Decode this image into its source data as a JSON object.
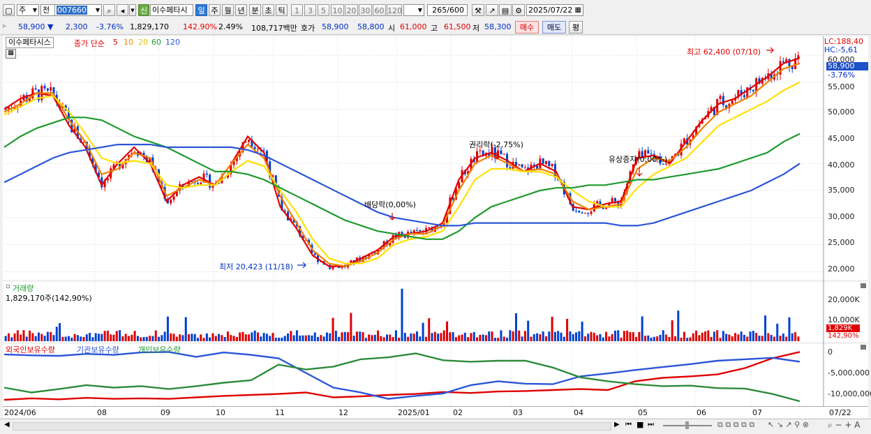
{
  "toolbar": {
    "market": "주",
    "range": "전",
    "code": "007660",
    "stock_name": "이수페타시",
    "badge": "신",
    "periods": [
      "일",
      "주",
      "월",
      "년",
      "분",
      "초",
      "틱"
    ],
    "active_period": "일",
    "intervals": [
      "1",
      "3",
      "5",
      "10",
      "20",
      "30",
      "60",
      "120"
    ],
    "count": "265",
    "count_total": "/600",
    "date": "2025/07/22"
  },
  "quote": {
    "price": "58,900",
    "change": "2,300",
    "change_pct": "-3.76%",
    "volume": "1,829,170",
    "vol_ratio": "142.90%",
    "turnover": "2.49%",
    "amount": "108,717백만",
    "ask_label": "호가",
    "ask": "58,900",
    "bid": "58,800",
    "open_label": "시",
    "open": "61,000",
    "high_label": "고",
    "high": "61,500",
    "low_label": "저",
    "low": "58,300",
    "buy": "매수",
    "sell": "매도",
    "eval": "평"
  },
  "price_panel": {
    "stock_tag": "이수페타시스",
    "ma_title": "종가 단순",
    "ma_periods": [
      "5",
      "10",
      "20",
      "60",
      "120"
    ],
    "lc": "LC:188,40",
    "hc": "HC:-5,61",
    "current_price": "58,900",
    "current_pct": "-3.76%",
    "high_note": "최고 62,400 (07/10)",
    "low_note": "최저 20,423 (11/18)",
    "ann_dividend": "배당락(0,00%)",
    "ann_rights": "권리락(-2,75%)",
    "ann_capital": "유상증자(0,00%)",
    "y_labels": [
      "60,000",
      "55,000",
      "50,000",
      "45,000",
      "40,000",
      "35,000",
      "30,000",
      "25,000",
      "20,000"
    ]
  },
  "volume_panel": {
    "title": "거래량",
    "value": "1,829,170주(142,90%)",
    "y_labels": [
      "20,000K",
      "10,000K"
    ],
    "current": "1,829K",
    "current_pct": "142,90%"
  },
  "holding_panel": {
    "legend": [
      "외국인보유수량",
      "기관보유수량",
      "개인보유수량"
    ],
    "y_labels": [
      "0",
      "-5,000,000",
      "-10,000,000"
    ]
  },
  "x_labels": [
    "2024/06",
    "08",
    "09",
    "10",
    "11",
    "12",
    "2025/01",
    "02",
    "03",
    "04",
    "05",
    "06",
    "07",
    "07/22"
  ],
  "colors": {
    "up": "#e00000",
    "down": "#0040d0",
    "ma5": "#e00000",
    "ma10": "#f08000",
    "ma20": "#ffe000",
    "ma60": "#1e9a2e",
    "ma120": "#2a55d8"
  },
  "chart_data": {
    "type": "candlestick",
    "price_ylim": [
      18500,
      63500
    ],
    "ma_series": [
      {
        "name": "5",
        "values": [
          50000,
          52000,
          53000,
          52500,
          47000,
          43000,
          36000,
          40000,
          43000,
          40000,
          33000,
          36000,
          37500,
          36000,
          40000,
          45000,
          42000,
          32000,
          28000,
          23000,
          21000,
          21000,
          22500,
          24000,
          26500,
          27000,
          27500,
          29000,
          37000,
          41000,
          42000,
          40500,
          38500,
          40000,
          38500,
          32000,
          31500,
          32500,
          33000,
          41000,
          41500,
          40000,
          44000,
          48000,
          51000,
          52000,
          54000,
          56000,
          58500,
          59500
        ]
      },
      {
        "name": "10",
        "values": [
          49500,
          51000,
          53000,
          53000,
          48000,
          44000,
          38000,
          39000,
          42000,
          41000,
          34000,
          35500,
          37000,
          36000,
          40000,
          43500,
          41000,
          34000,
          29000,
          24000,
          21500,
          21000,
          22000,
          23500,
          26000,
          27000,
          27000,
          28500,
          35000,
          40000,
          41500,
          40000,
          38500,
          39000,
          38000,
          33000,
          31500,
          32000,
          32500,
          39000,
          41000,
          40500,
          43000,
          46500,
          49500,
          51000,
          52500,
          55000,
          57500,
          58500
        ]
      },
      {
        "name": "20",
        "values": [
          49000,
          50500,
          52000,
          52500,
          49500,
          45500,
          41000,
          40000,
          40500,
          40000,
          36000,
          35500,
          36000,
          36000,
          38500,
          40500,
          39500,
          35000,
          31000,
          26000,
          22500,
          21500,
          21500,
          22500,
          25000,
          26000,
          26500,
          27500,
          32000,
          37000,
          39000,
          39000,
          38500,
          38500,
          37500,
          35000,
          33000,
          32000,
          32000,
          35500,
          38000,
          39500,
          41000,
          44000,
          47000,
          48500,
          50000,
          51500,
          53500,
          55000
        ]
      },
      {
        "name": "60",
        "values": [
          43000,
          45000,
          46500,
          47500,
          48500,
          48500,
          48000,
          46500,
          45000,
          44000,
          43000,
          41500,
          40000,
          38500,
          38500,
          38000,
          37000,
          35500,
          34000,
          32500,
          31000,
          29500,
          28500,
          27500,
          27000,
          26500,
          26000,
          26000,
          27500,
          30000,
          32000,
          33000,
          34000,
          35000,
          35500,
          35500,
          36000,
          36000,
          36500,
          37000,
          37000,
          37500,
          38000,
          38500,
          39000,
          40000,
          41000,
          42000,
          44000,
          45500
        ]
      },
      {
        "name": "120",
        "values": [
          36500,
          38000,
          39500,
          41000,
          42000,
          42500,
          43000,
          43500,
          43500,
          43500,
          43000,
          43000,
          43000,
          43000,
          43000,
          42500,
          41500,
          40000,
          38500,
          37000,
          35500,
          34000,
          32500,
          31000,
          30000,
          29500,
          29000,
          28500,
          28500,
          29000,
          29000,
          29000,
          29000,
          29000,
          29000,
          29000,
          29000,
          29000,
          28500,
          28500,
          29000,
          30000,
          31000,
          32000,
          33000,
          34000,
          35000,
          36500,
          38000,
          40000
        ]
      }
    ],
    "volume_ylim": [
      0,
      25000
    ],
    "holding_ylim": [
      -11000000,
      1000000
    ]
  }
}
